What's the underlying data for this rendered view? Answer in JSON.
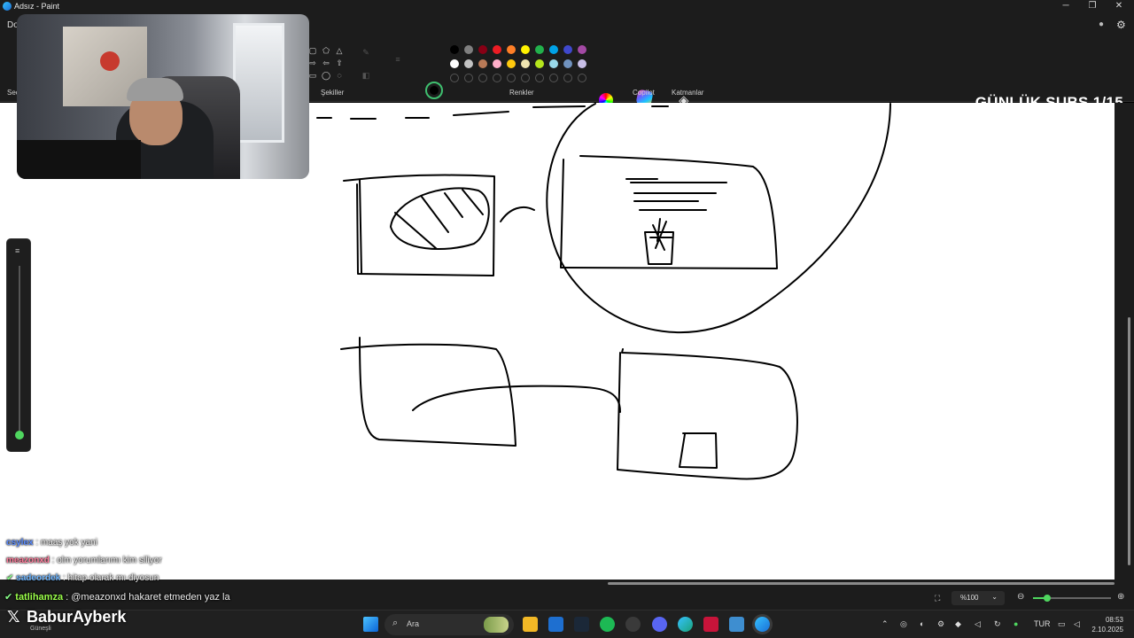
{
  "window": {
    "title": "Adsız - Paint"
  },
  "menu": {
    "first_label": "Do"
  },
  "ribbon": {
    "selection_label": "Seç",
    "shapes_label": "Şekiller",
    "colors_label": "Renkler",
    "copilot_label": "Copilot",
    "layers_label": "Katmanlar",
    "palette_row1": [
      "#000000",
      "#7f7f7f",
      "#880015",
      "#ed1c24",
      "#ff7f27",
      "#fff200",
      "#22b14c",
      "#00a2e8",
      "#3f48cc",
      "#a349a4"
    ],
    "palette_row2": [
      "#ffffff",
      "#c3c3c3",
      "#b97a57",
      "#ffaec9",
      "#ffc90e",
      "#efe4b0",
      "#b5e61d",
      "#99d9ea",
      "#7092be",
      "#c8bfe7"
    ],
    "primary_color": "#000000",
    "secondary_color": "#ffffff"
  },
  "overlay": {
    "subs_banner": "GÜNLÜK SUBS 1/15",
    "brand_name": "BaburAyberk",
    "chat": [
      {
        "user": "csylex",
        "user_color": "#5b8cff",
        "message": " : maaş yok yani"
      },
      {
        "user": "meazonxd",
        "user_color": "#ff7a9a",
        "message": " : olm yorumlarımı kim siliyor"
      },
      {
        "user": "sadeordek",
        "user_color": "#6fb6ff",
        "message": " : hitap olarak mı diyosun"
      },
      {
        "user": "tatlihamza",
        "user_color": "#9bff4a",
        "message": " : @meazonxd hakaret etmeden yaz la"
      }
    ]
  },
  "status": {
    "zoom": "%100"
  },
  "taskbar": {
    "search_placeholder": "Ara",
    "weather": "Güneşli",
    "language": "TUR",
    "time": "08:53",
    "date": "2.10.2025"
  }
}
